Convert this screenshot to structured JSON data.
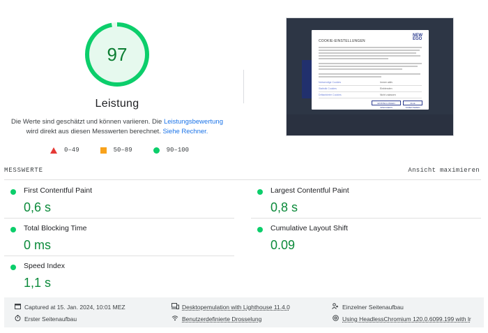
{
  "score": {
    "value": "97",
    "fraction": 0.97,
    "title": "Leistung",
    "desc_part1": "Die Werte sind geschätzt und können variieren. Die ",
    "desc_link1": "Leistungsbewertung",
    "desc_part2": " wird direkt aus diesen Messwerten berechnet. ",
    "desc_link2": "Siehe Rechner.",
    "color": "#0cce6b"
  },
  "legend": [
    {
      "label": "0–49",
      "icon": "triangle-icon",
      "color": "#e53935"
    },
    {
      "label": "50–89",
      "icon": "square-icon",
      "color": "#f8a21c"
    },
    {
      "label": "90–100",
      "icon": "circle-icon",
      "color": "#0cce6b"
    }
  ],
  "thumbnail": {
    "modal_title": "COOKIE-EINSTELLUNGEN",
    "brand_logo": "NEW EGO",
    "rows": [
      {
        "label": "Notwendige Cookies",
        "value": "Immer aktiv"
      },
      {
        "label": "Statistik Cookies",
        "value": "Einblenden"
      },
      {
        "label": "Drittanbieter Cookies",
        "value": "Nicht zulassen"
      }
    ],
    "button_left": "EINSTELLUNGEN SPEICHERN",
    "button_right": "ALLE AKZEPTIEREN"
  },
  "metrics": {
    "header": "MESSWERTE",
    "expand_label": "Ansicht maximieren",
    "items": [
      {
        "name": "First Contentful Paint",
        "value": "0,6 s"
      },
      {
        "name": "Largest Contentful Paint",
        "value": "0,8 s"
      },
      {
        "name": "Total Blocking Time",
        "value": "0 ms"
      },
      {
        "name": "Cumulative Layout Shift",
        "value": "0.09"
      },
      {
        "name": "Speed Index",
        "value": "1,1 s"
      }
    ]
  },
  "footer": {
    "captured": "Captured at 15. Jan. 2024, 10:01 MEZ",
    "first_load": "Erster Seitenaufbau",
    "emulation": "Desktopemulation with Lighthouse 11.4.0",
    "throttling": "Benutzerdefinierte Drosselung",
    "single_load": "Einzelner Seitenaufbau",
    "browser": "Using HeadlessChromium 120.0.6099.199 with lr"
  }
}
